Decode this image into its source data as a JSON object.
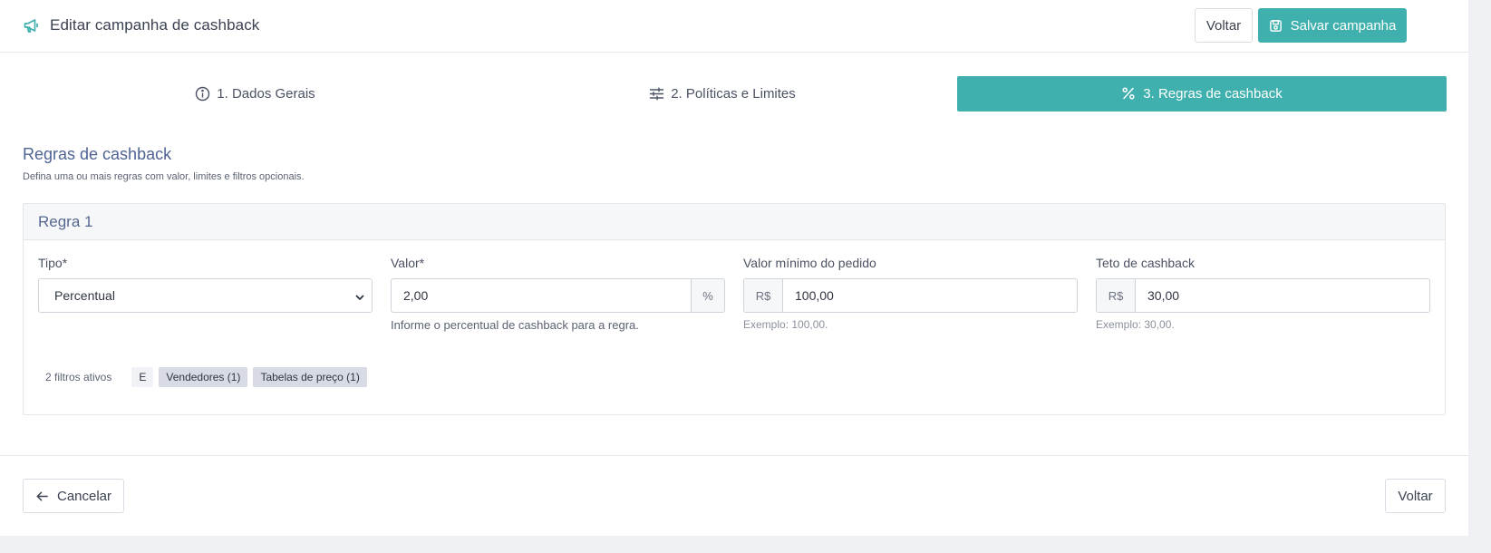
{
  "header": {
    "title": "Editar campanha de cashback",
    "icon": "megaphone-icon",
    "back_label": "Voltar",
    "save_label": "Salvar campanha"
  },
  "steps": [
    {
      "label": "1.  Dados Gerais",
      "icon": "info-icon",
      "active": false
    },
    {
      "label": "2.  Políticas e Limites",
      "icon": "sliders-icon",
      "active": false
    },
    {
      "label": "3.  Regras de cashback",
      "icon": "percent-icon",
      "active": true
    }
  ],
  "section": {
    "title": "Regras de cashback",
    "subtitle": "Defina uma ou mais regras com valor, limites e filtros opcionais."
  },
  "rule": {
    "title": "Regra 1",
    "tipo": {
      "label": "Tipo*",
      "value": "Percentual"
    },
    "valor": {
      "label": "Valor*",
      "value": "2,00",
      "suffix": "%",
      "help": "Informe o percentual de cashback para a regra."
    },
    "minimo": {
      "label": "Valor mínimo do pedido",
      "prefix": "R$",
      "value": "100,00",
      "help": "Exemplo: 100,00."
    },
    "teto": {
      "label": "Teto de cashback",
      "prefix": "R$",
      "value": "30,00",
      "help": "Exemplo: 30,00."
    },
    "filters": {
      "count_label": "2 filtros ativos",
      "operator": "E",
      "tags": [
        "Vendedores (1)",
        "Tabelas de preço (1)"
      ]
    }
  },
  "footer": {
    "cancel_label": "Cancelar",
    "back_label": "Voltar"
  },
  "colors": {
    "accent": "#3fb0ad",
    "section_title": "#4f6292",
    "page_bg": "#eef0f3"
  }
}
